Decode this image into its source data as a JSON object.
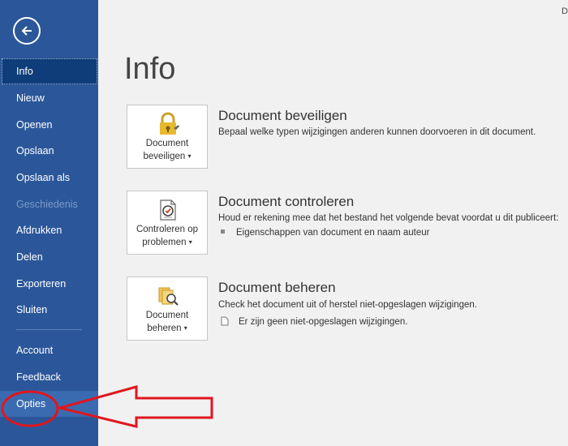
{
  "window": {
    "user_initial": "D"
  },
  "sidebar": {
    "items": [
      {
        "label": "Info",
        "state": "active"
      },
      {
        "label": "Nieuw"
      },
      {
        "label": "Openen"
      },
      {
        "label": "Opslaan"
      },
      {
        "label": "Opslaan als"
      },
      {
        "label": "Geschiedenis",
        "state": "disabled"
      },
      {
        "label": "Afdrukken"
      },
      {
        "label": "Delen"
      },
      {
        "label": "Exporteren"
      },
      {
        "label": "Sluiten"
      },
      {
        "label": "Account"
      },
      {
        "label": "Feedback"
      },
      {
        "label": "Opties",
        "state": "highlighted"
      }
    ]
  },
  "main": {
    "title": "Info",
    "sections": [
      {
        "tile_line1": "Document",
        "tile_line2": "beveiligen",
        "tile_icon": "lock-icon",
        "title": "Document beveiligen",
        "description": "Bepaal welke typen wijzigingen anderen kunnen doorvoeren in dit document."
      },
      {
        "tile_line1": "Controleren op",
        "tile_line2": "problemen",
        "tile_icon": "inspect-document-icon",
        "title": "Document controleren",
        "description": "Houd er rekening mee dat het bestand het volgende bevat voordat u dit publiceert:",
        "bullet": "Eigenschappen van document en naam auteur"
      },
      {
        "tile_line1": "Document",
        "tile_line2": "beheren",
        "tile_icon": "manage-document-icon",
        "title": "Document beheren",
        "description": "Check het document uit of herstel niet-opgeslagen wijzigingen.",
        "bullet": "Er zijn geen niet-opgeslagen wijzigingen."
      }
    ]
  },
  "annotation": {
    "color": "#e0161e"
  },
  "colors": {
    "sidebar": "#2b579a",
    "sidebar_active": "#0f3d7a"
  }
}
